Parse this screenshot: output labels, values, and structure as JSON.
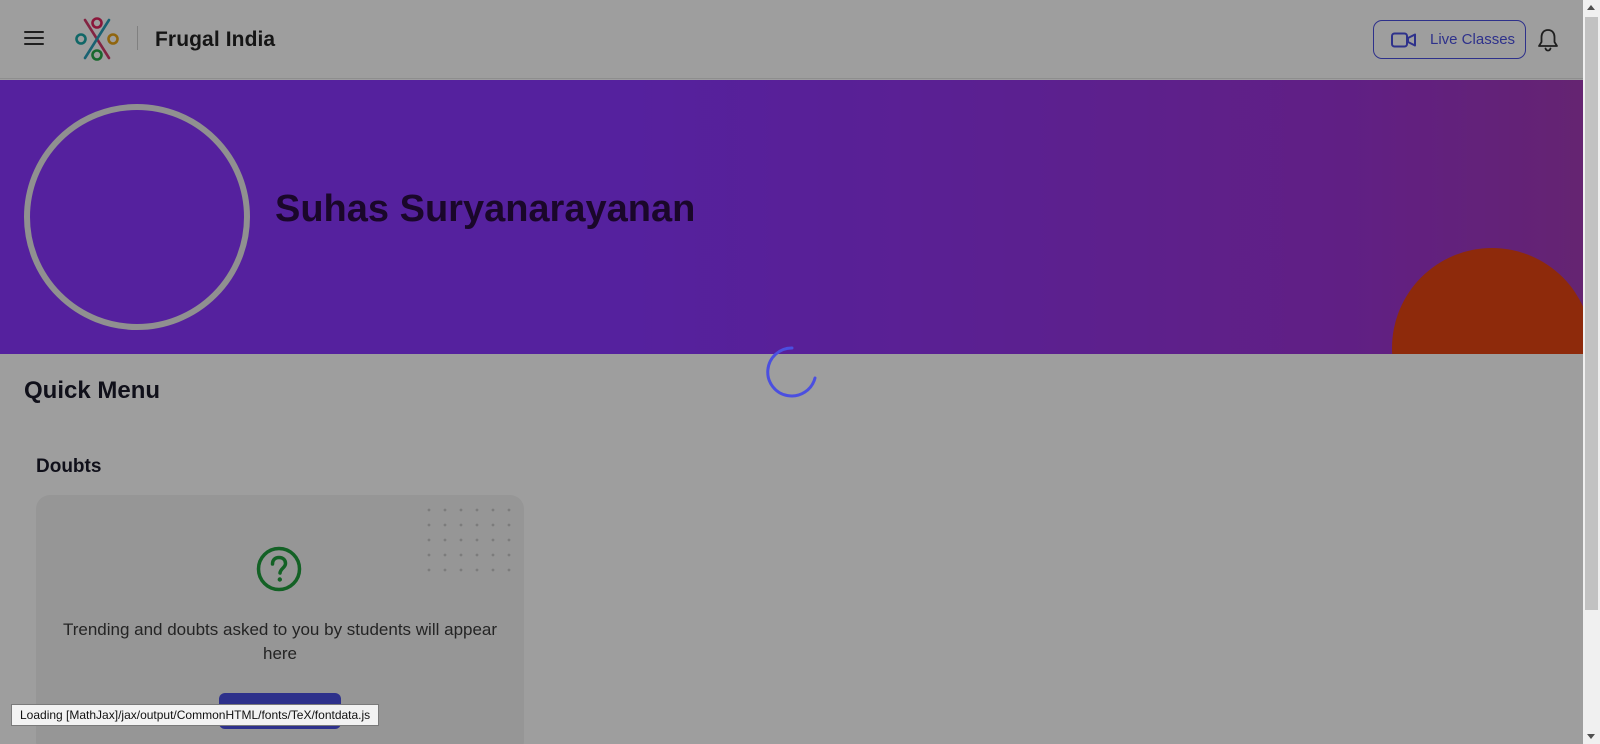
{
  "header": {
    "brand": "Frugal India",
    "live_classes_label": "Live Classes"
  },
  "profile": {
    "name": "Suhas Suryanarayanan"
  },
  "quick_menu": {
    "title": "Quick Menu",
    "sections": [
      {
        "title": "Doubts",
        "empty_text": "Trending and doubts asked to you by students will appear here"
      }
    ]
  },
  "status_bar": {
    "text": "Loading [MathJax]/jax/output/CommonHTML/fonts/TeX/fontdata.js"
  },
  "colors": {
    "accent": "#4b4fe0",
    "banner": "#8a36ff",
    "banner_circle": "#e64513",
    "doubt_icon": "#1f9d3c"
  },
  "icons": {
    "menu": "hamburger-menu-icon",
    "logo": "frugal-india-logo",
    "live": "video-camera-icon",
    "notifications": "bell-icon",
    "doubt": "question-circle-icon",
    "loading": "spinner-icon"
  }
}
